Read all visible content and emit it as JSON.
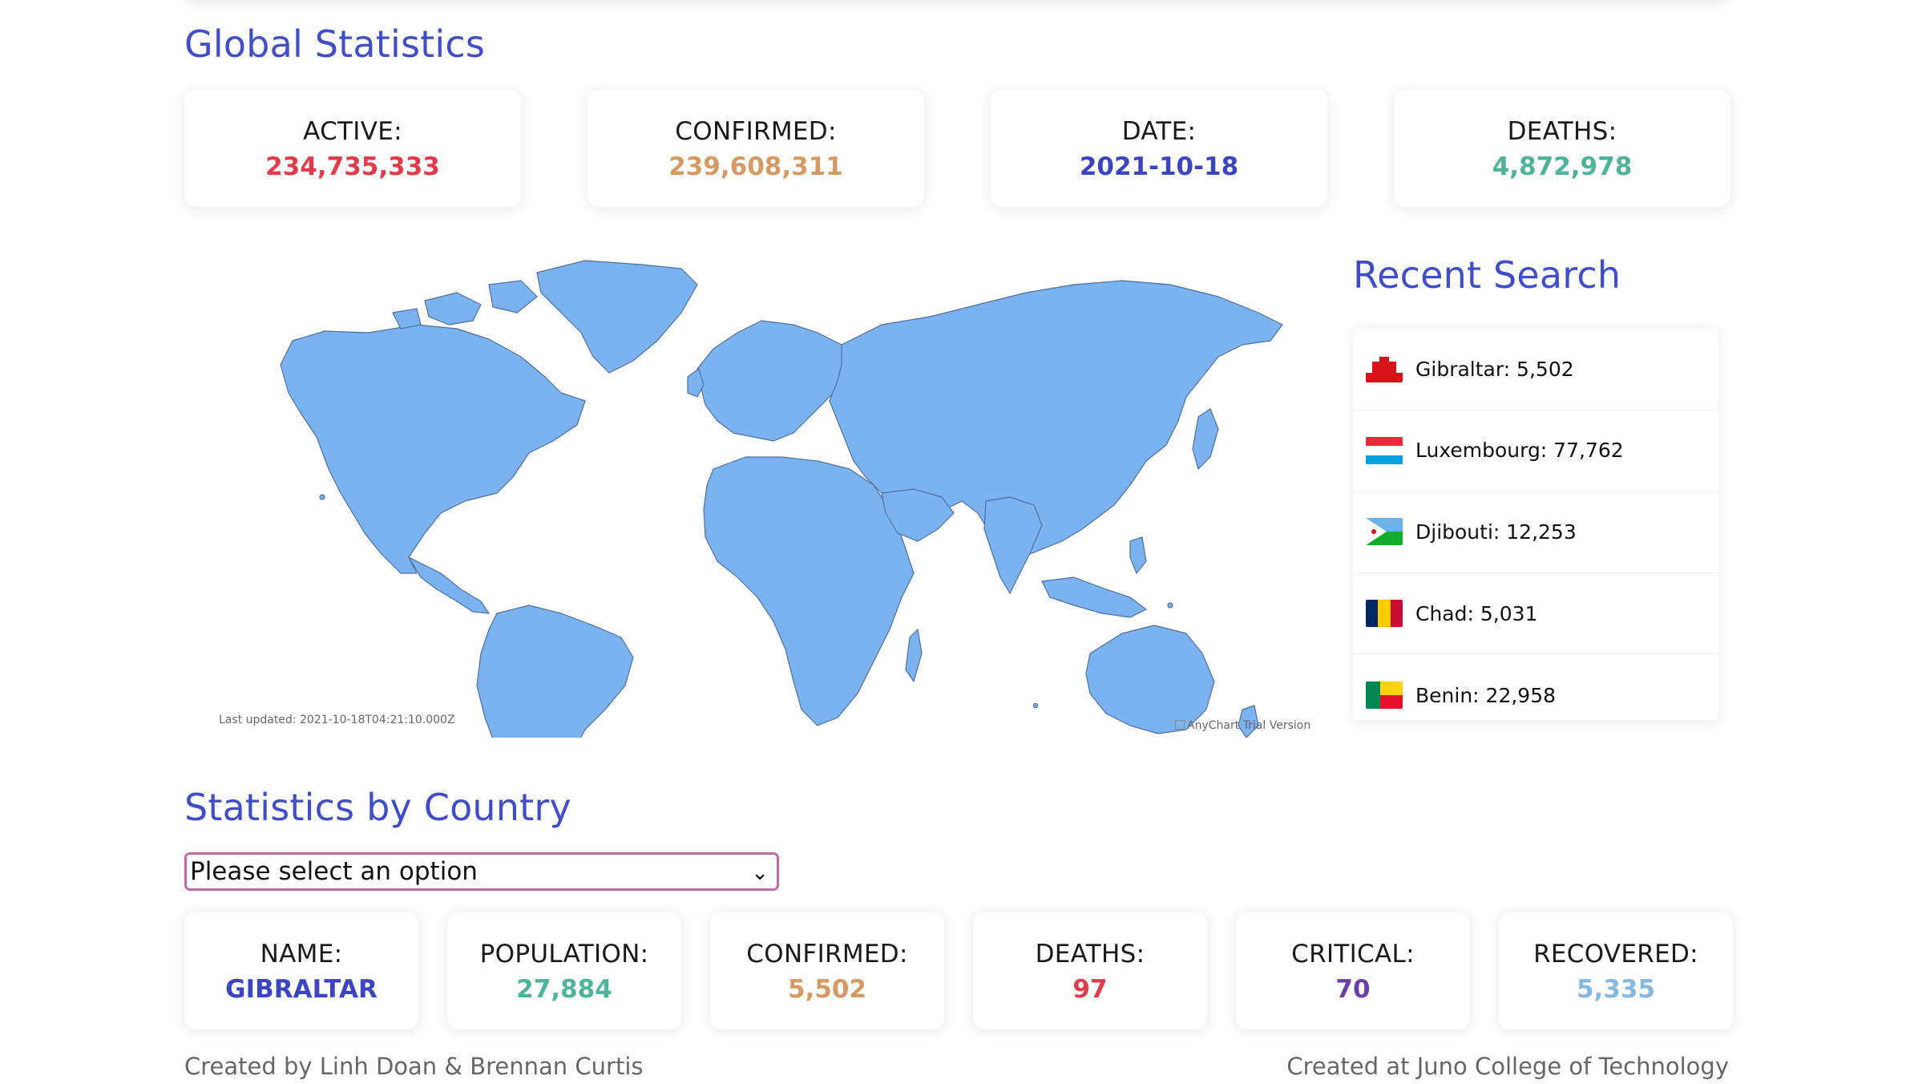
{
  "global": {
    "title": "Global Statistics",
    "cards": [
      {
        "label": "ACTIVE:",
        "value": "234,735,333",
        "color": "#e23c4a"
      },
      {
        "label": "CONFIRMED:",
        "value": "239,608,311",
        "color": "#d59a62"
      },
      {
        "label": "DATE:",
        "value": "2021-10-18",
        "color": "#3b45bf"
      },
      {
        "label": "DEATHS:",
        "value": "4,872,978",
        "color": "#4fb39a"
      }
    ]
  },
  "map": {
    "last_updated": "Last updated: 2021-10-18T04:21:10.000Z",
    "credit": "AnyChart Trial Version",
    "land_color": "#7ab3f0"
  },
  "recent": {
    "title": "Recent Search",
    "items": [
      {
        "text": "Gibraltar: 5,502",
        "flag": "gibraltar"
      },
      {
        "text": "Luxembourg: 77,762",
        "flag": "luxembourg"
      },
      {
        "text": "Djibouti: 12,253",
        "flag": "djibouti"
      },
      {
        "text": "Chad: 5,031",
        "flag": "chad"
      },
      {
        "text": "Benin: 22,958",
        "flag": "benin"
      }
    ]
  },
  "country": {
    "title": "Statistics by Country",
    "select_value": "Please select an option",
    "cards": [
      {
        "label": "NAME:",
        "value": "GIBRALTAR",
        "color": "#3b45bf"
      },
      {
        "label": "POPULATION:",
        "value": "27,884",
        "color": "#4fb39a"
      },
      {
        "label": "CONFIRMED:",
        "value": "5,502",
        "color": "#d59a62"
      },
      {
        "label": "DEATHS:",
        "value": "97",
        "color": "#e23c4a"
      },
      {
        "label": "CRITICAL:",
        "value": "70",
        "color": "#6a3ea8"
      },
      {
        "label": "RECOVERED:",
        "value": "5,335",
        "color": "#86b7dc"
      }
    ]
  },
  "footer": {
    "left": "Created by Linh Doan & Brennan Curtis",
    "right": "Created at Juno College of Technology"
  }
}
